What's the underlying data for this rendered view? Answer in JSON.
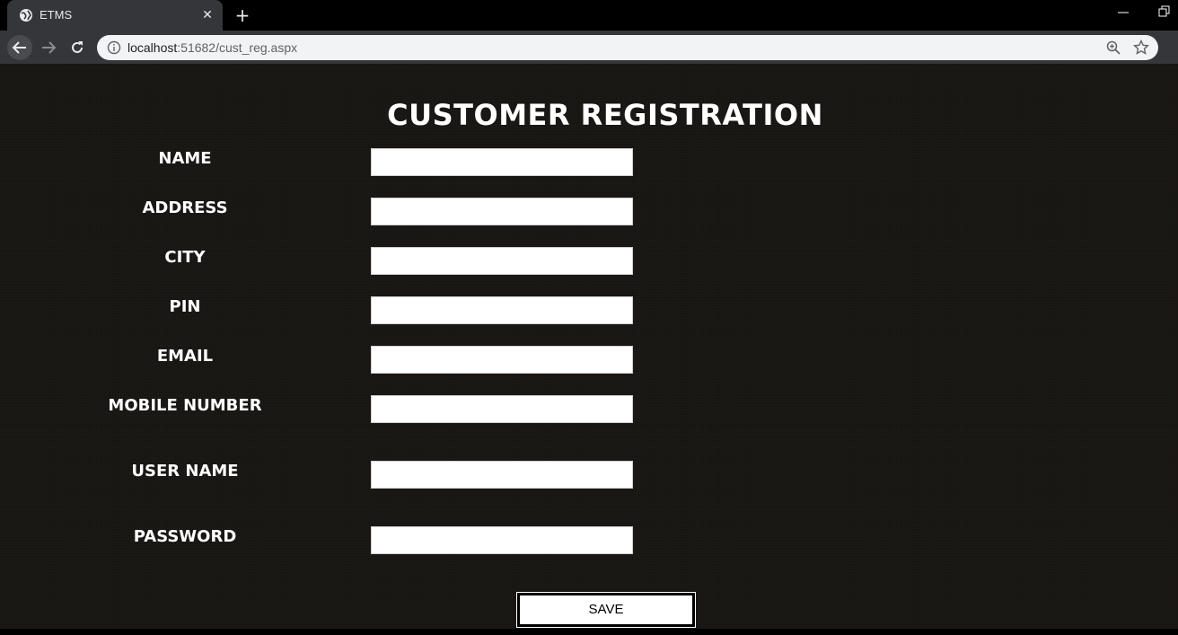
{
  "browser": {
    "tab_title": "ETMS",
    "url_host": "localhost",
    "url_path": ":51682/cust_reg.aspx"
  },
  "page": {
    "heading": "CUSTOMER REGISTRATION",
    "fields": [
      {
        "label": "NAME",
        "value": ""
      },
      {
        "label": "ADDRESS",
        "value": ""
      },
      {
        "label": "CITY",
        "value": ""
      },
      {
        "label": "PIN",
        "value": ""
      },
      {
        "label": "EMAIL",
        "value": ""
      },
      {
        "label": "MOBILE NUMBER",
        "value": ""
      },
      {
        "label": "USER NAME",
        "value": ""
      },
      {
        "label": "PASSWORD",
        "value": ""
      }
    ],
    "save_label": "SAVE"
  },
  "colors": {
    "page_background": "#181512",
    "text": "#ffffff",
    "chrome_toolbar": "#35363a"
  },
  "icons": [
    "globe-icon",
    "close-icon",
    "plus-icon",
    "minimize-icon",
    "restore-icon",
    "back-arrow-icon",
    "forward-arrow-icon",
    "reload-icon",
    "info-icon",
    "zoom-icon",
    "star-icon",
    "profile-icon"
  ]
}
